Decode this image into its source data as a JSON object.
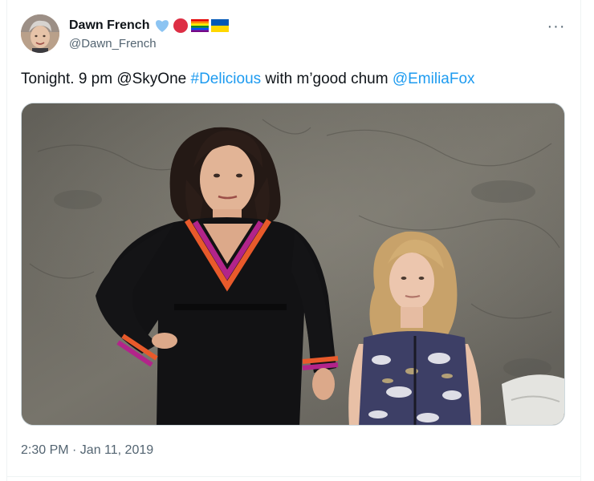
{
  "tweet": {
    "author": {
      "display_name": "Dawn French",
      "handle": "@Dawn_French",
      "badges": [
        "blue-heart",
        "red-circle",
        "rainbow-flag",
        "ukraine-flag"
      ]
    },
    "more_label": "···",
    "text": {
      "part1": "Tonight. 9 pm @SkyOne ",
      "hashtag": "#Delicious",
      "part2": " with m’good chum ",
      "mention": "@EmiliaFox"
    },
    "timestamp": "2:30 PM · Jan 11, 2019"
  },
  "colors": {
    "link": "#1d9bf0",
    "secondary_text": "#536471",
    "primary_text": "#0f1419"
  }
}
